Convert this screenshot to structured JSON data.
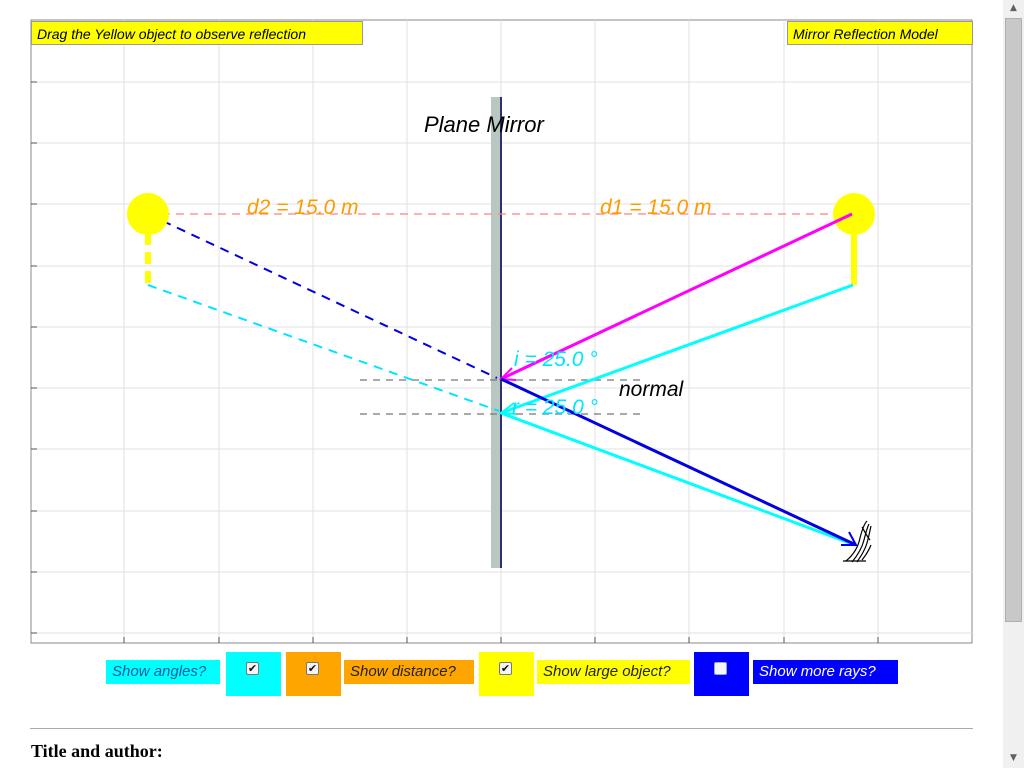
{
  "header": {
    "instruction": "Drag the Yellow object to observe reflection",
    "model_title": "Mirror Reflection Model"
  },
  "diagram": {
    "mirror_label": "Plane Mirror",
    "d2_label": "d2 = 15.0 m",
    "d1_label": "d1 = 15.0 m",
    "incident_angle_label": "i = 25.0 °",
    "reflected_angle_label": "r = 25.0 °",
    "normal_label": "normal",
    "colors": {
      "object": "#ffff00",
      "incident_ray": "#ff00ff",
      "reflected_ray": "#0000e0",
      "secondary_ray": "#00ffff",
      "distance_line": "#ff8080",
      "distance_text": "#ff9a00",
      "angle_text": "#00e5ff",
      "mirror_glass": "#b8c8c0",
      "mirror_line": "#303070"
    }
  },
  "controls": {
    "show_angles": {
      "label": "Show angles?",
      "checked": true,
      "color": "#00ffff"
    },
    "show_distance": {
      "label": "Show distance?",
      "checked": true,
      "color": "#ffa500"
    },
    "show_large_object": {
      "label": "Show large object?",
      "checked": true,
      "color": "#ffff00"
    },
    "show_more_rays": {
      "label": "Show more rays?",
      "checked": false,
      "color": "#0000ff"
    }
  },
  "footer": {
    "title_author_label": "Title and author:"
  }
}
